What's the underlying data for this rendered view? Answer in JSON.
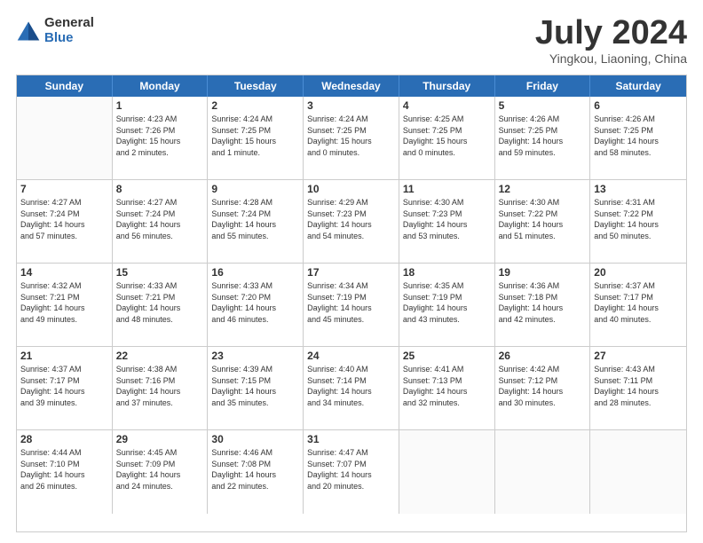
{
  "header": {
    "logo_general": "General",
    "logo_blue": "Blue",
    "month_title": "July 2024",
    "location": "Yingkou, Liaoning, China"
  },
  "weekdays": [
    "Sunday",
    "Monday",
    "Tuesday",
    "Wednesday",
    "Thursday",
    "Friday",
    "Saturday"
  ],
  "weeks": [
    [
      {
        "day": "",
        "lines": []
      },
      {
        "day": "1",
        "lines": [
          "Sunrise: 4:23 AM",
          "Sunset: 7:26 PM",
          "Daylight: 15 hours",
          "and 2 minutes."
        ]
      },
      {
        "day": "2",
        "lines": [
          "Sunrise: 4:24 AM",
          "Sunset: 7:25 PM",
          "Daylight: 15 hours",
          "and 1 minute."
        ]
      },
      {
        "day": "3",
        "lines": [
          "Sunrise: 4:24 AM",
          "Sunset: 7:25 PM",
          "Daylight: 15 hours",
          "and 0 minutes."
        ]
      },
      {
        "day": "4",
        "lines": [
          "Sunrise: 4:25 AM",
          "Sunset: 7:25 PM",
          "Daylight: 15 hours",
          "and 0 minutes."
        ]
      },
      {
        "day": "5",
        "lines": [
          "Sunrise: 4:26 AM",
          "Sunset: 7:25 PM",
          "Daylight: 14 hours",
          "and 59 minutes."
        ]
      },
      {
        "day": "6",
        "lines": [
          "Sunrise: 4:26 AM",
          "Sunset: 7:25 PM",
          "Daylight: 14 hours",
          "and 58 minutes."
        ]
      }
    ],
    [
      {
        "day": "7",
        "lines": [
          "Sunrise: 4:27 AM",
          "Sunset: 7:24 PM",
          "Daylight: 14 hours",
          "and 57 minutes."
        ]
      },
      {
        "day": "8",
        "lines": [
          "Sunrise: 4:27 AM",
          "Sunset: 7:24 PM",
          "Daylight: 14 hours",
          "and 56 minutes."
        ]
      },
      {
        "day": "9",
        "lines": [
          "Sunrise: 4:28 AM",
          "Sunset: 7:24 PM",
          "Daylight: 14 hours",
          "and 55 minutes."
        ]
      },
      {
        "day": "10",
        "lines": [
          "Sunrise: 4:29 AM",
          "Sunset: 7:23 PM",
          "Daylight: 14 hours",
          "and 54 minutes."
        ]
      },
      {
        "day": "11",
        "lines": [
          "Sunrise: 4:30 AM",
          "Sunset: 7:23 PM",
          "Daylight: 14 hours",
          "and 53 minutes."
        ]
      },
      {
        "day": "12",
        "lines": [
          "Sunrise: 4:30 AM",
          "Sunset: 7:22 PM",
          "Daylight: 14 hours",
          "and 51 minutes."
        ]
      },
      {
        "day": "13",
        "lines": [
          "Sunrise: 4:31 AM",
          "Sunset: 7:22 PM",
          "Daylight: 14 hours",
          "and 50 minutes."
        ]
      }
    ],
    [
      {
        "day": "14",
        "lines": [
          "Sunrise: 4:32 AM",
          "Sunset: 7:21 PM",
          "Daylight: 14 hours",
          "and 49 minutes."
        ]
      },
      {
        "day": "15",
        "lines": [
          "Sunrise: 4:33 AM",
          "Sunset: 7:21 PM",
          "Daylight: 14 hours",
          "and 48 minutes."
        ]
      },
      {
        "day": "16",
        "lines": [
          "Sunrise: 4:33 AM",
          "Sunset: 7:20 PM",
          "Daylight: 14 hours",
          "and 46 minutes."
        ]
      },
      {
        "day": "17",
        "lines": [
          "Sunrise: 4:34 AM",
          "Sunset: 7:19 PM",
          "Daylight: 14 hours",
          "and 45 minutes."
        ]
      },
      {
        "day": "18",
        "lines": [
          "Sunrise: 4:35 AM",
          "Sunset: 7:19 PM",
          "Daylight: 14 hours",
          "and 43 minutes."
        ]
      },
      {
        "day": "19",
        "lines": [
          "Sunrise: 4:36 AM",
          "Sunset: 7:18 PM",
          "Daylight: 14 hours",
          "and 42 minutes."
        ]
      },
      {
        "day": "20",
        "lines": [
          "Sunrise: 4:37 AM",
          "Sunset: 7:17 PM",
          "Daylight: 14 hours",
          "and 40 minutes."
        ]
      }
    ],
    [
      {
        "day": "21",
        "lines": [
          "Sunrise: 4:37 AM",
          "Sunset: 7:17 PM",
          "Daylight: 14 hours",
          "and 39 minutes."
        ]
      },
      {
        "day": "22",
        "lines": [
          "Sunrise: 4:38 AM",
          "Sunset: 7:16 PM",
          "Daylight: 14 hours",
          "and 37 minutes."
        ]
      },
      {
        "day": "23",
        "lines": [
          "Sunrise: 4:39 AM",
          "Sunset: 7:15 PM",
          "Daylight: 14 hours",
          "and 35 minutes."
        ]
      },
      {
        "day": "24",
        "lines": [
          "Sunrise: 4:40 AM",
          "Sunset: 7:14 PM",
          "Daylight: 14 hours",
          "and 34 minutes."
        ]
      },
      {
        "day": "25",
        "lines": [
          "Sunrise: 4:41 AM",
          "Sunset: 7:13 PM",
          "Daylight: 14 hours",
          "and 32 minutes."
        ]
      },
      {
        "day": "26",
        "lines": [
          "Sunrise: 4:42 AM",
          "Sunset: 7:12 PM",
          "Daylight: 14 hours",
          "and 30 minutes."
        ]
      },
      {
        "day": "27",
        "lines": [
          "Sunrise: 4:43 AM",
          "Sunset: 7:11 PM",
          "Daylight: 14 hours",
          "and 28 minutes."
        ]
      }
    ],
    [
      {
        "day": "28",
        "lines": [
          "Sunrise: 4:44 AM",
          "Sunset: 7:10 PM",
          "Daylight: 14 hours",
          "and 26 minutes."
        ]
      },
      {
        "day": "29",
        "lines": [
          "Sunrise: 4:45 AM",
          "Sunset: 7:09 PM",
          "Daylight: 14 hours",
          "and 24 minutes."
        ]
      },
      {
        "day": "30",
        "lines": [
          "Sunrise: 4:46 AM",
          "Sunset: 7:08 PM",
          "Daylight: 14 hours",
          "and 22 minutes."
        ]
      },
      {
        "day": "31",
        "lines": [
          "Sunrise: 4:47 AM",
          "Sunset: 7:07 PM",
          "Daylight: 14 hours",
          "and 20 minutes."
        ]
      },
      {
        "day": "",
        "lines": []
      },
      {
        "day": "",
        "lines": []
      },
      {
        "day": "",
        "lines": []
      }
    ]
  ]
}
